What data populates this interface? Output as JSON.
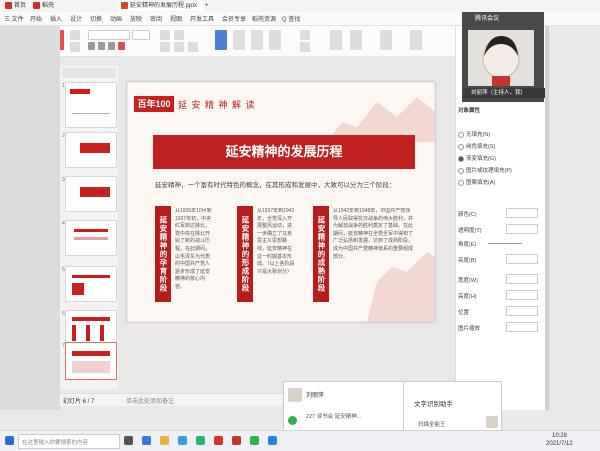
{
  "titlebar": {
    "tabs": [
      {
        "label": "首页",
        "color": "#c7342c"
      },
      {
        "label": "稻壳",
        "color": "#c7342c"
      },
      {
        "label": "延安精神的发展历程.pptx",
        "color": "#d24726"
      },
      {
        "label": "+",
        "color": ""
      }
    ],
    "app_title": "腾讯会议"
  },
  "menubar": {
    "items": [
      "三 文件",
      "开始",
      "插入",
      "设计",
      "切换",
      "动画",
      "放映",
      "审阅",
      "视图",
      "开发工具",
      "会员专享",
      "稻壳资源",
      "Q 查找"
    ]
  },
  "slide": {
    "badge_number": "百年100",
    "badge_label": "延 安 精 神 解 读",
    "title": "延安精神的发展历程",
    "intro": "延安精神，一个富有时代特色的概念，在其形成和发展中，大致可以分为三个阶段：",
    "columns": [
      {
        "heading": "延安精神的孕育阶段",
        "text": "从1935年10月到1937年初，中央红军到达陕北，党中央在陕北开始了新的战斗历程，在此期间，以毛泽东为代表的中国共产党人逐步形成了延安精神的核心内容。"
      },
      {
        "heading": "延安精神的形成阶段",
        "text": "从1937年到1942年，全党深入开展整风运动，进一步确立了马克思主义思想路线，延安精神在这一时期基本形成。（以上各阶段只是大致划分）"
      },
      {
        "heading": "延安精神的成熟阶段",
        "text": "从1942年到1948年，中国共产党领导人民取得抗日战争的伟大胜利，并为解放战争的胜利奠定了基础。在此期间，延安精神在全党全军中得到了广泛弘扬和发展，达到了成熟阶段，成为中国共产党精神谱系的重要组成部分。"
      }
    ]
  },
  "thumbnails": {
    "numbers": [
      "1",
      "2",
      "3",
      "4",
      "5",
      "6",
      "7"
    ],
    "selected": "6"
  },
  "statusbar": {
    "slide_info": "幻灯片 6 / 7",
    "notes": "单击此处添加备注"
  },
  "rightpane": {
    "title": "对象属性",
    "fill_options": [
      "无填充(N)",
      "纯色填充(S)",
      "渐变填充(G)",
      "图片或纹理填充(P)",
      "图案填充(A)"
    ],
    "props": [
      "颜色(C)",
      "透明度(T)",
      "角度(E)",
      "亮度(B)",
      "宽度(W)",
      "高度(H)",
      "位置",
      "图片缩放"
    ]
  },
  "video": {
    "meeting_label": "腾讯会议",
    "participant_name": "刘丽萍（主持人，我）"
  },
  "popup1": {
    "title": "刘丽萍",
    "message": "227 读书会 延安精神..."
  },
  "popup2": {
    "title": "文字识别助手",
    "message": "扫描全能王"
  },
  "taskbar": {
    "search_placeholder": "在这里输入你要搜索的内容",
    "time": "10:28",
    "date": "2021/7/12"
  },
  "colors": {
    "accent_red": "#c0201f",
    "slide_bg": "#fdf7f4"
  }
}
